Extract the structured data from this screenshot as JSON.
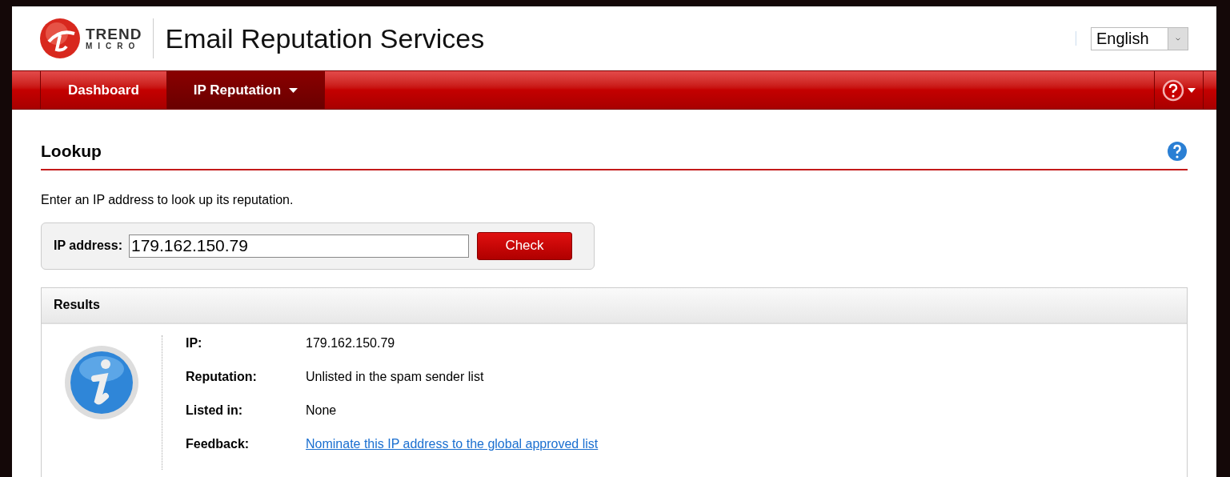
{
  "header": {
    "logo_top": "TREND",
    "logo_bottom": "MICRO",
    "title": "Email Reputation Services",
    "language": "English"
  },
  "nav": {
    "tabs": [
      {
        "label": "Dashboard",
        "selected": false,
        "dropdown": false
      },
      {
        "label": "IP Reputation",
        "selected": true,
        "dropdown": true
      }
    ]
  },
  "page": {
    "title": "Lookup",
    "intro": "Enter an IP address to look up its reputation.",
    "form": {
      "label": "IP address:",
      "value": "179.162.150.79",
      "button": "Check"
    },
    "results": {
      "title": "Results",
      "rows": [
        {
          "kind": "text",
          "label": "IP:",
          "value": "179.162.150.79"
        },
        {
          "kind": "text",
          "label": "Reputation:",
          "value": "Unlisted in the spam sender list"
        },
        {
          "kind": "text",
          "label": "Listed in:",
          "value": "None"
        },
        {
          "kind": "link",
          "label": "Feedback:",
          "value": "Nominate this IP address to the global approved list"
        }
      ]
    }
  }
}
